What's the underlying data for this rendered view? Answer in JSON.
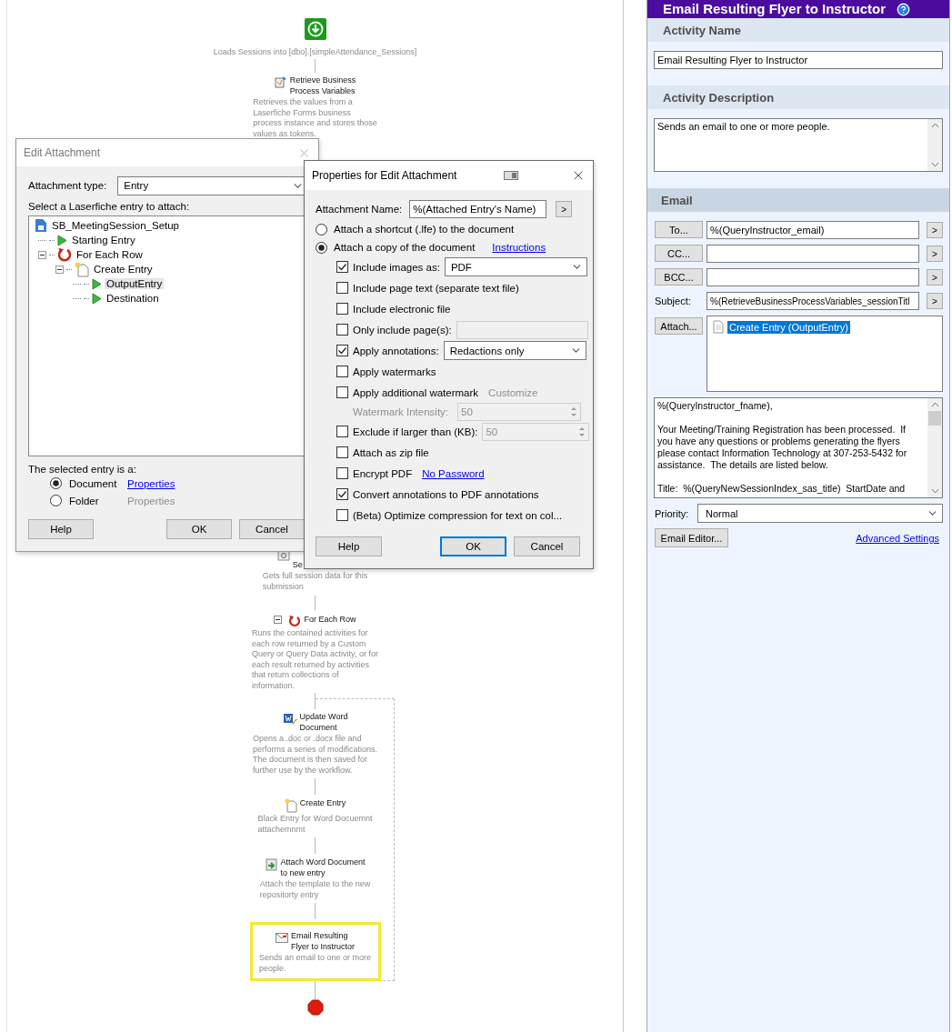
{
  "workflow": {
    "start_caption": "Loads Sessions into [dbo].[simpleAttendance_Sessions]",
    "upper_activities": [
      {
        "kind": "variables",
        "title": "Retrieve Business\nProcess Variables",
        "description": "Retrieves the values from a\nLaserfiche Forms business\nprocess instance and stores those\nvalues as tokens.",
        "selected": false
      }
    ],
    "lower_activities": [
      {
        "kind": "query",
        "title": "Se",
        "description": "Gets full session data for this\nsubmission",
        "selected": false
      },
      {
        "kind": "loop",
        "title": "For Each Row",
        "expanded": true,
        "description": "Runs the contained activities for\neach row returned by a Custom\nQuery or Query Data activity, or for\neach result returned by activities\nthat return collections of\ninformation.",
        "selected": false
      }
    ],
    "loop_activities": [
      {
        "kind": "word",
        "title": "Update Word\nDocument",
        "description": "Opens a .doc or .docx file and\nperforms a series of modifications.\nThe document is then saved for\nfurther use by the workflow.",
        "selected": false
      },
      {
        "kind": "create",
        "title": "Create Entry",
        "description": "Black Entry for Word Docuemnt\nattachemnmt",
        "selected": false
      },
      {
        "kind": "attach",
        "title": "Attach Word Document\nto new entry",
        "description": "Attach the template to the new\nrepositorty entry",
        "selected": false
      },
      {
        "kind": "email",
        "title": "Email Resulting\nFlyer to Instructor",
        "description": "Sends an email to one or more\npeople.",
        "selected": true
      }
    ]
  },
  "edit_attachment_dialog": {
    "title": "Edit Attachment",
    "type_label": "Attachment type:",
    "type_value": "Entry",
    "tree_label": "Select a Laserfiche entry to attach:",
    "tree": [
      {
        "label": "SB_MeetingSession_Setup",
        "kind": "workflow",
        "selected": false,
        "children": [
          {
            "label": "Starting Entry",
            "kind": "entry",
            "selected": false
          },
          {
            "label": "For Each Row",
            "kind": "loop",
            "selected": false,
            "expanded": true,
            "children": [
              {
                "label": "Create Entry",
                "kind": "create",
                "selected": false,
                "expanded": true,
                "children": [
                  {
                    "label": "OutputEntry",
                    "kind": "entry",
                    "selected": true
                  },
                  {
                    "label": "Destination",
                    "kind": "entry",
                    "selected": false
                  }
                ]
              }
            ]
          }
        ]
      }
    ],
    "selected_label": "The selected entry is a:",
    "entry_types": [
      {
        "label": "Document",
        "selected": true,
        "link": "Properties"
      },
      {
        "label": "Folder",
        "selected": false,
        "link": "Properties"
      }
    ],
    "buttons": [
      {
        "label": "Help",
        "default": false
      },
      {
        "label": "OK",
        "default": false
      },
      {
        "label": "Cancel",
        "default": false
      }
    ]
  },
  "properties_dialog": {
    "title": "Properties for Edit Attachment",
    "name_label": "Attachment Name:",
    "name_value": "%(Attached Entry's Name)",
    "name_button": ">",
    "modes": [
      {
        "label": "Attach a shortcut (.lfe) to the document",
        "selected": false
      },
      {
        "label": "Attach a copy of the document",
        "selected": true,
        "link": "Instructions"
      }
    ],
    "options": [
      {
        "kind": "select",
        "label": "Include images as:",
        "checked": true,
        "value": "PDF"
      },
      {
        "kind": "plain",
        "label": "Include page text (separate text file)",
        "checked": false
      },
      {
        "kind": "plain",
        "label": "Include electronic file",
        "checked": false
      },
      {
        "kind": "field",
        "label": "Only include page(s):",
        "checked": false
      },
      {
        "kind": "select",
        "label": "Apply annotations:",
        "checked": true,
        "value": "Redactions only"
      },
      {
        "kind": "plain",
        "label": "Apply watermarks",
        "checked": false
      },
      {
        "kind": "link",
        "label": "Apply additional watermark",
        "checked": false,
        "link": "Customize",
        "link_disabled": true
      },
      {
        "kind": "spinner",
        "label": "Watermark Intensity:",
        "value": "50",
        "disabled": true
      },
      {
        "kind": "check_spinner",
        "label": "Exclude if larger than (KB):",
        "checked": false,
        "value": "50"
      },
      {
        "kind": "plain",
        "label": "Attach as zip file",
        "checked": false
      },
      {
        "kind": "link",
        "label": "Encrypt PDF",
        "checked": false,
        "link": "No Password",
        "link_disabled": false
      },
      {
        "kind": "plain",
        "label": "Convert annotations to PDF annotations",
        "checked": true
      },
      {
        "kind": "plain",
        "label": "(Beta) Optimize compression for text on col...",
        "checked": false
      }
    ],
    "buttons": [
      {
        "label": "Help",
        "default": false
      },
      {
        "label": "OK",
        "default": true
      },
      {
        "label": "Cancel",
        "default": false
      }
    ]
  },
  "properties_panel": {
    "title": "Email Resulting Flyer to Instructor",
    "activity_name_header": "Activity Name",
    "activity_name": "Email Resulting Flyer to Instructor",
    "activity_description_header": "Activity Description",
    "activity_description": "Sends an email to one or more people.",
    "email_header": "Email",
    "recipients": [
      {
        "button": "To...",
        "value": "%(QueryInstructor_email)",
        "insert": ">"
      },
      {
        "button": "CC...",
        "insert": ">"
      },
      {
        "button": "BCC...",
        "insert": ">"
      }
    ],
    "subject_label": "Subject:",
    "subject": "%(RetrieveBusinessProcessVariables_sessionTitl",
    "subject_insert": ">",
    "attach_button": "Attach...",
    "attachments": [
      {
        "label": "Create Entry (OutputEntry)",
        "selected": true
      }
    ],
    "body": "%(QueryInstructor_fname),\n\nYour Meeting/Training Registration has been processed.  If\nyou have any questions or problems generating the flyers\nplease contact Information Technology at 307-253-5432 for\nassistance.  The details are listed below.\n\nTitle:  %(QueryNewSessionIndex_sas_title)  StartDate and",
    "priority_label": "Priority:",
    "priority": "Normal",
    "editor_button": "Email Editor...",
    "advanced_link": "Advanced Settings"
  }
}
